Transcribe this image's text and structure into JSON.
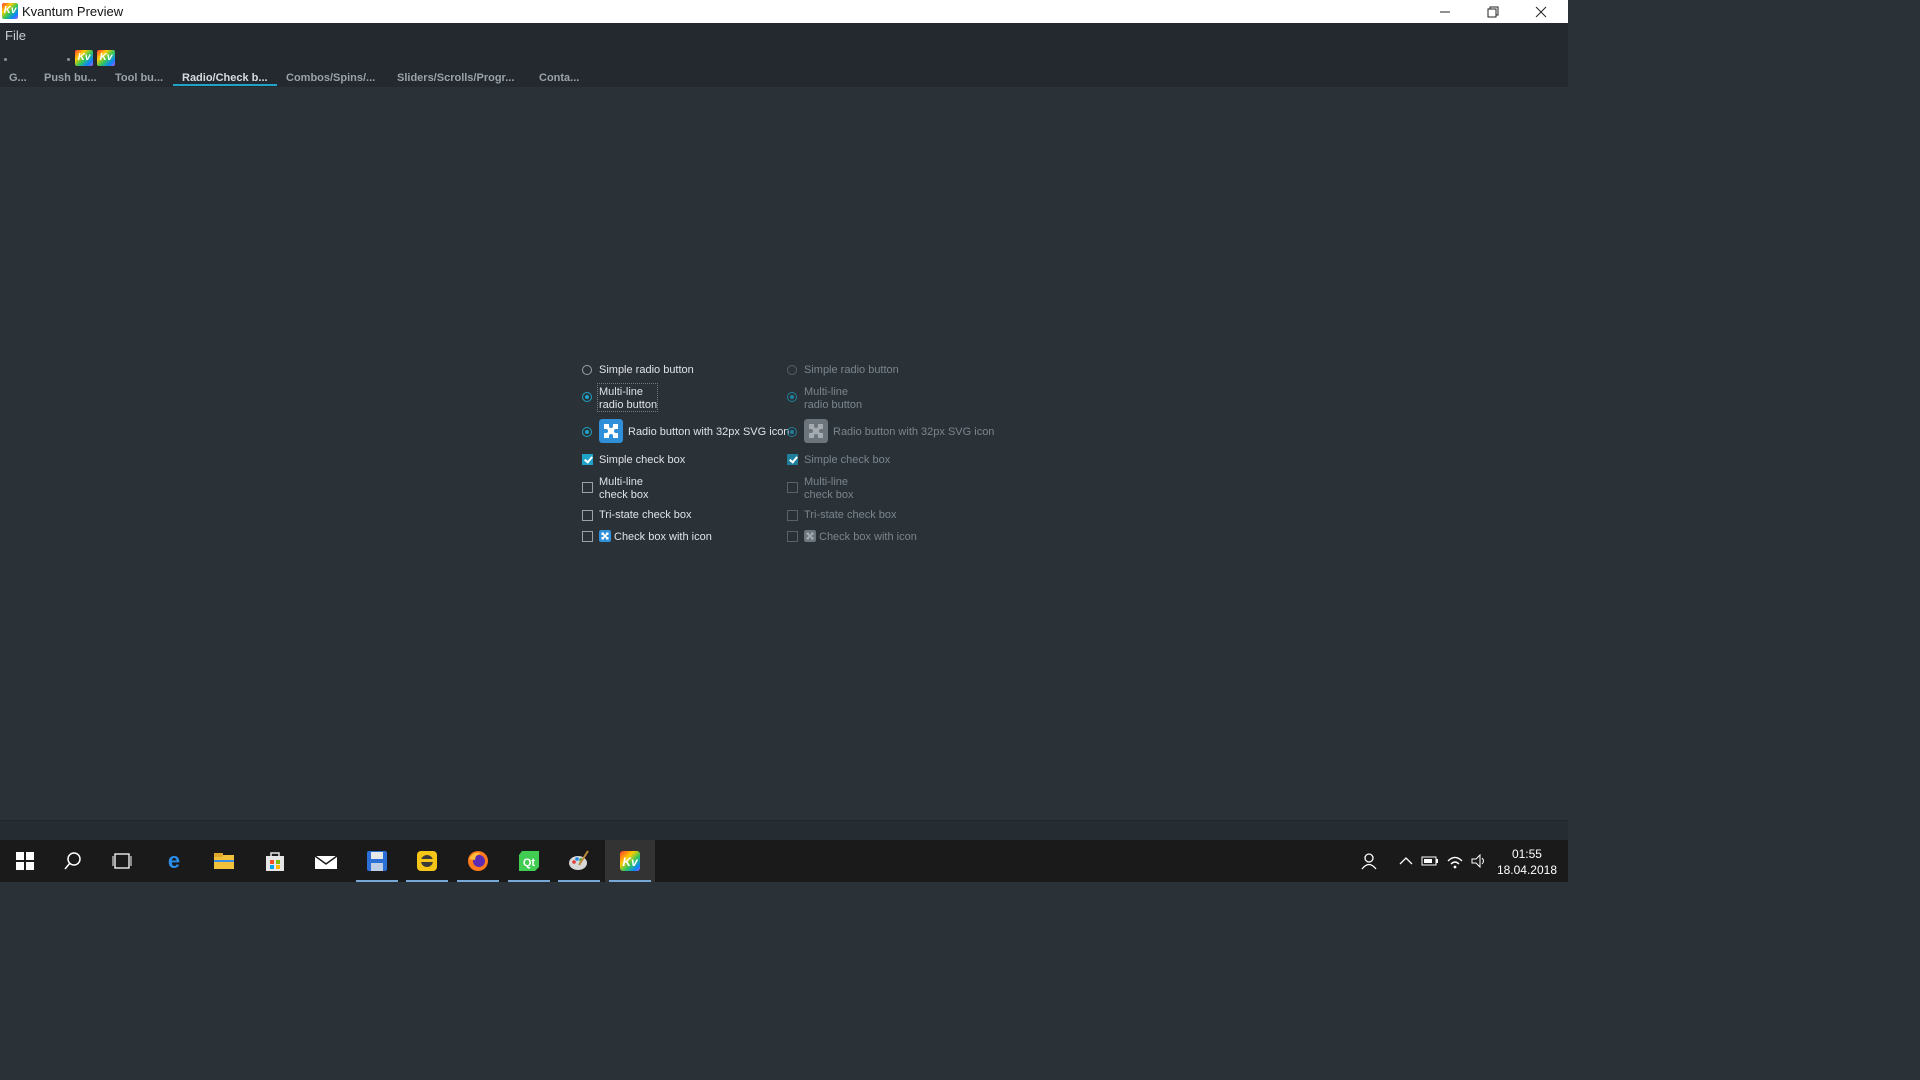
{
  "window": {
    "title": "Kvantum Preview",
    "app_icon": "Kv"
  },
  "menu": {
    "file": "File"
  },
  "toolbar": {
    "icon_label": "Kv"
  },
  "tabs": [
    {
      "label": "G..."
    },
    {
      "label": "Push bu..."
    },
    {
      "label": "Tool bu..."
    },
    {
      "label": "Radio/Check b..."
    },
    {
      "label": "Combos/Spins/..."
    },
    {
      "label": "Sliders/Scrolls/Progr..."
    },
    {
      "label": "Conta..."
    }
  ],
  "active_tab": "Radio/Check b...",
  "enabled": {
    "simple_radio": "Simple radio button",
    "multiline_radio_1": "Multi-line",
    "multiline_radio_2": "radio button",
    "svg_radio": "Radio button with 32px SVG icon",
    "simple_check": "Simple check box",
    "multiline_check_1": "Multi-line",
    "multiline_check_2": "check box",
    "tristate_check": "Tri-state check box",
    "icon_check": "Check box with icon"
  },
  "disabled": {
    "simple_radio": "Simple radio button",
    "multiline_radio_1": "Multi-line",
    "multiline_radio_2": "radio button",
    "svg_radio": "Radio button with 32px SVG icon",
    "simple_check": "Simple check box",
    "multiline_check_1": "Multi-line",
    "multiline_check_2": "check box",
    "tristate_check": "Tri-state check box",
    "icon_check": "Check box with icon"
  },
  "clock": {
    "time": "01:55",
    "date": "18.04.2018"
  },
  "colors": {
    "accent": "#1fa3c8",
    "background": "#2a3238",
    "bar": "#23292e"
  },
  "taskbar_icons": [
    "windows-start-icon",
    "search-icon",
    "task-view-icon",
    "edge-icon",
    "file-explorer-icon",
    "store-icon",
    "mail-icon",
    "floppy-app-icon",
    "yellow-app-icon",
    "firefox-icon",
    "qt-creator-icon",
    "paint-icon",
    "kvantum-icon"
  ]
}
